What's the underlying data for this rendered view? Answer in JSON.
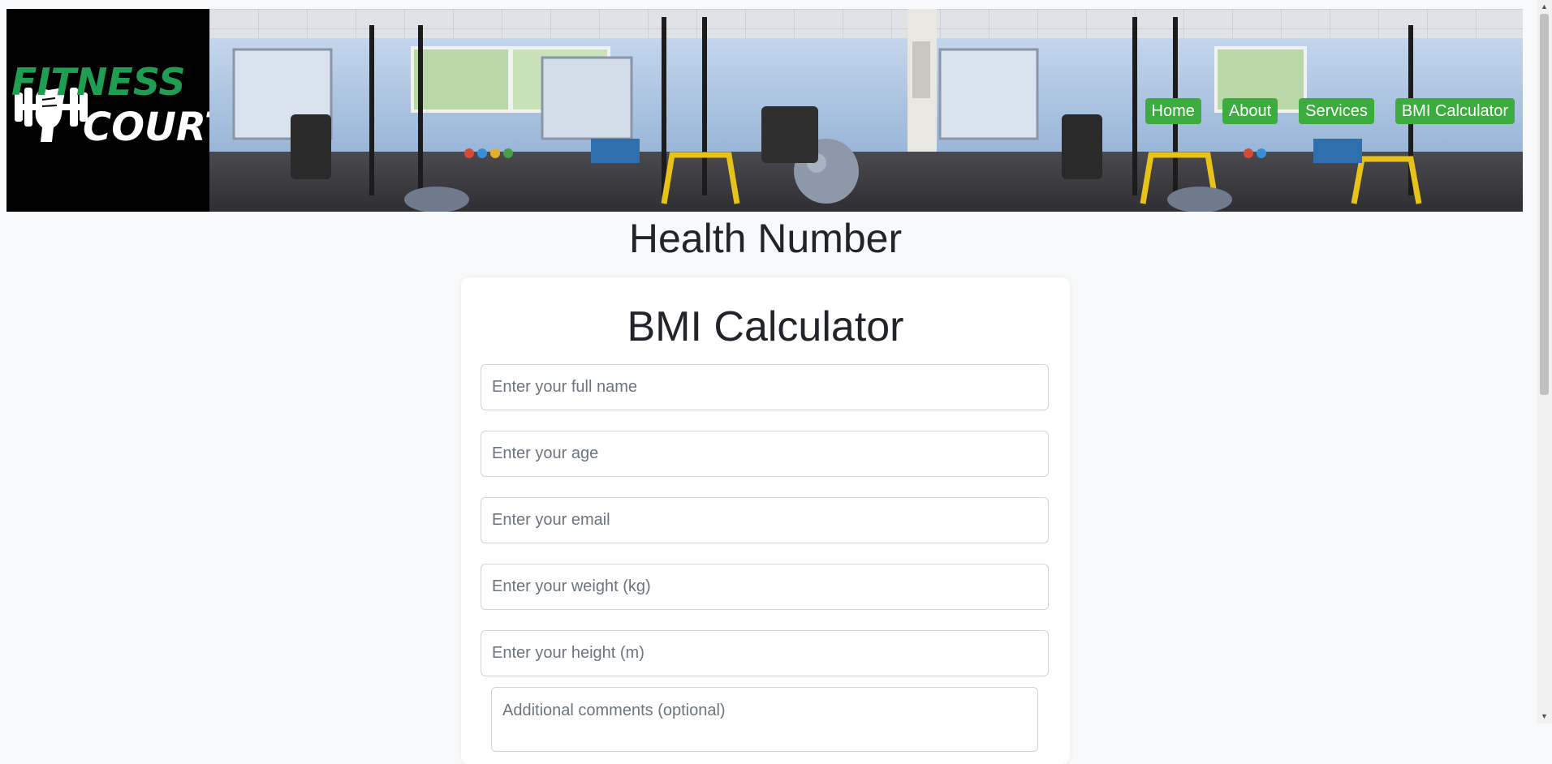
{
  "brand": {
    "line1": "FITNESS",
    "line2": "COURT"
  },
  "nav": {
    "items": [
      {
        "label": "Home"
      },
      {
        "label": "About"
      },
      {
        "label": "Services"
      },
      {
        "label": "BMI Calculator"
      }
    ]
  },
  "main": {
    "heading": "Health Number"
  },
  "form": {
    "title": "BMI Calculator",
    "name_placeholder": "Enter your full name",
    "age_placeholder": "Enter your age",
    "email_placeholder": "Enter your email",
    "weight_placeholder": "Enter your weight (kg)",
    "height_placeholder": "Enter your height (m)",
    "comments_placeholder": "Additional comments (optional)"
  },
  "colors": {
    "nav_accent": "#3dac3f",
    "logo_green": "#1f9d52",
    "page_background": "#f8f9fa"
  },
  "icons": {
    "logo": "dumbbell-fist-logo",
    "banner": "gym-interior-photo"
  }
}
